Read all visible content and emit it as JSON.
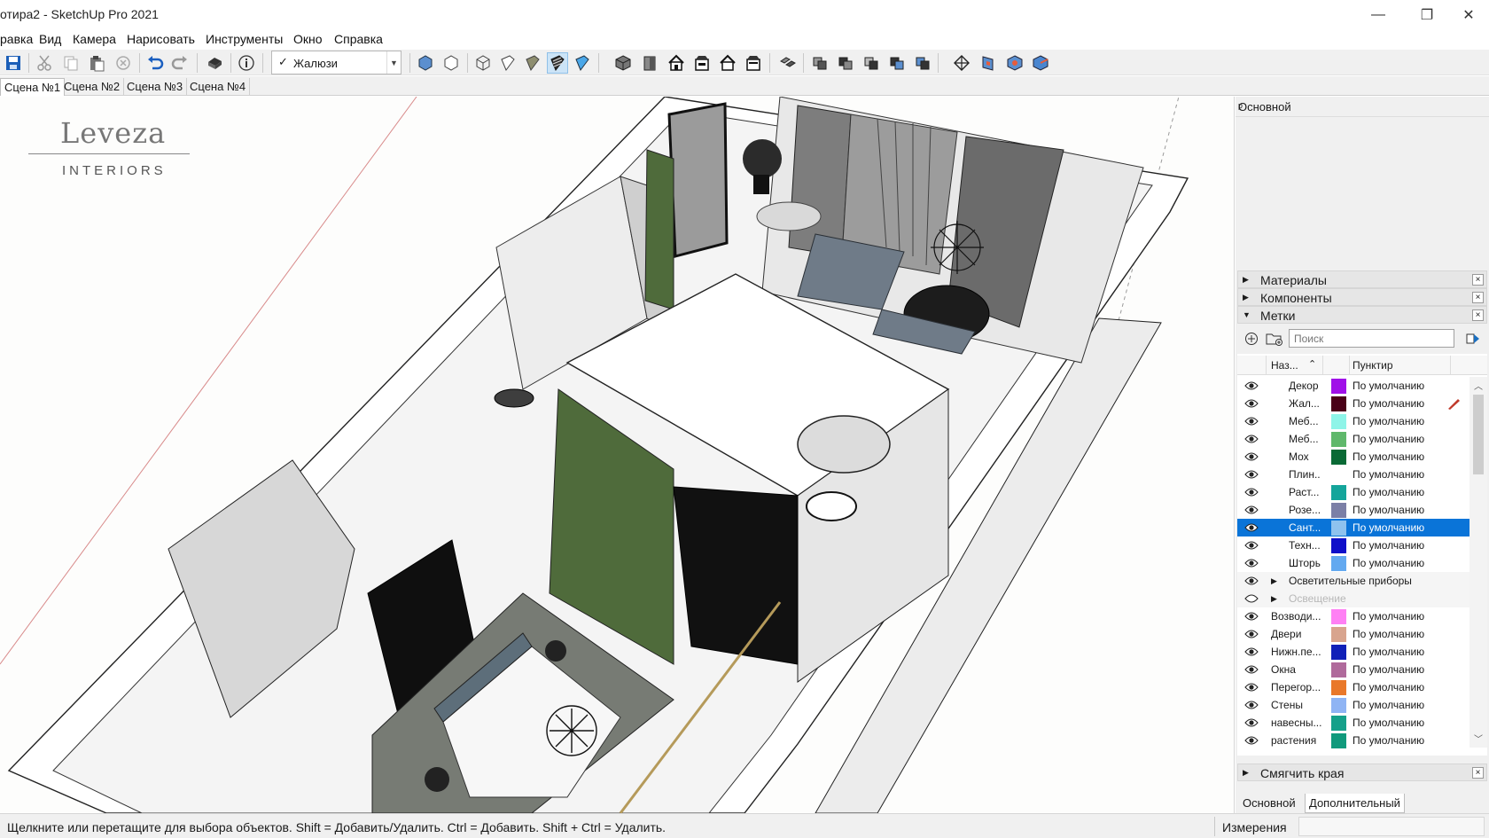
{
  "window": {
    "title": "отира2 - SketchUp Pro 2021",
    "minimize": "—",
    "maximize": "❐",
    "close": "✕"
  },
  "menu": [
    "равка",
    "Вид",
    "Камера",
    "Нарисовать",
    "Инструменты",
    "Окно",
    "Справка"
  ],
  "toolbar": {
    "tag_dropdown": {
      "selected": "Жалюзи",
      "check": "✓"
    }
  },
  "scenes": [
    "Сцена №1",
    "Сцена №2",
    "Сцена №3",
    "Сцена №4"
  ],
  "viewport": {
    "logo": {
      "main": "Leveza",
      "sub": "INTERIORS"
    }
  },
  "tray": {
    "title": "Основной",
    "pin": "ᵖ",
    "sections": {
      "materials": "Материалы",
      "components": "Компоненты",
      "tags": "Метки",
      "soften": "Смягчить края"
    },
    "close": "×",
    "search_placeholder": "Поиск",
    "columns": {
      "name": "Наз...",
      "dash": "Пунктир"
    },
    "tags": [
      {
        "name": "Декор",
        "color": "#a010e8",
        "dash": "По умолчанию"
      },
      {
        "name": "Жал...",
        "color": "#4a0018",
        "dash": "По умолчанию"
      },
      {
        "name": "Меб...",
        "color": "#8ef4e8",
        "dash": "По умолчанию"
      },
      {
        "name": "Меб...",
        "color": "#5fb86b",
        "dash": "По умолчанию"
      },
      {
        "name": "Мох",
        "color": "#0a6a35",
        "dash": "По умолчанию"
      },
      {
        "name": "Плин...",
        "color": "",
        "dash": "По умолчанию"
      },
      {
        "name": "Раст...",
        "color": "#14a59b",
        "dash": "По умолчанию"
      },
      {
        "name": "Розе...",
        "color": "#7b7fa6",
        "dash": "По умолчанию"
      },
      {
        "name": "Сант...",
        "color": "#8ec2ee",
        "dash": "По умолчанию",
        "selected": true
      },
      {
        "name": "Техн...",
        "color": "#0f0fc9",
        "dash": "По умолчанию"
      },
      {
        "name": "Шторы",
        "color": "#63a9f0",
        "dash": "По умолчанию"
      }
    ],
    "groups": [
      {
        "name": "Осветительные приборы",
        "visible": true
      },
      {
        "name": "Освещение",
        "visible": false
      }
    ],
    "tags2": [
      {
        "name": "Возводи...",
        "color": "#ff80f4",
        "dash": "По умолчанию"
      },
      {
        "name": "Двери",
        "color": "#d8a48e",
        "dash": "По умолчанию"
      },
      {
        "name": "Нижн.пе...",
        "color": "#1020b8",
        "dash": "По умолчанию"
      },
      {
        "name": "Окна",
        "color": "#b06a9c",
        "dash": "По умолчанию"
      },
      {
        "name": "Перегор...",
        "color": "#e9782a",
        "dash": "По умолчанию"
      },
      {
        "name": "Стены",
        "color": "#8fb4f4",
        "dash": "По умолчанию"
      },
      {
        "name": "навесны...",
        "color": "#15a08a",
        "dash": "По умолчанию"
      },
      {
        "name": "растения",
        "color": "#109a7c",
        "dash": "По умолчанию"
      }
    ],
    "bottom_tabs": [
      "Основной",
      "Дополнительный"
    ]
  },
  "status": {
    "message": "Щелкните или перетащите для выбора объектов. Shift = Добавить/Удалить. Ctrl = Добавить. Shift + Ctrl = Удалить.",
    "measure_label": "Измерения"
  }
}
